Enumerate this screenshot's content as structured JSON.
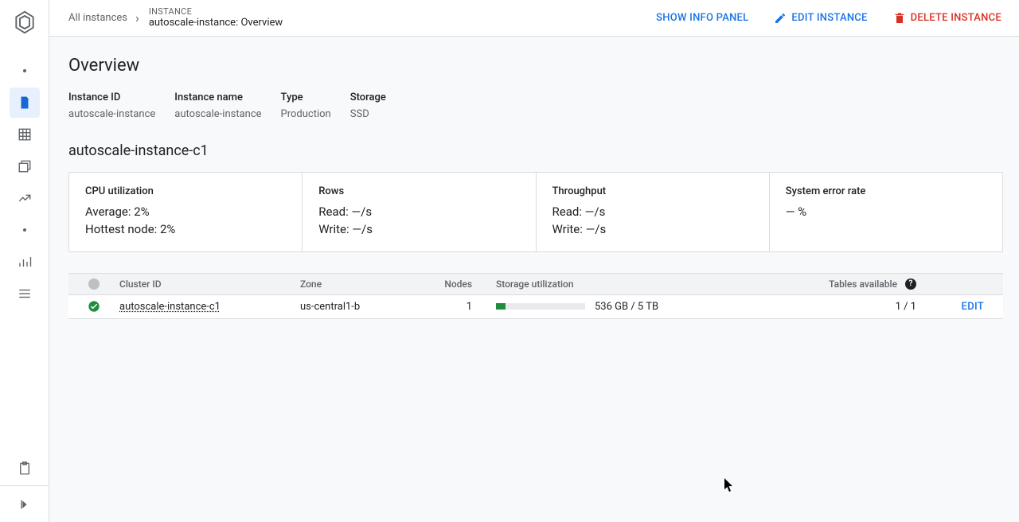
{
  "breadcrumbs": {
    "root": "All instances",
    "label": "INSTANCE",
    "title": "autoscale-instance: Overview"
  },
  "actions": {
    "show_info": "SHOW INFO PANEL",
    "edit": "EDIT INSTANCE",
    "delete": "DELETE INSTANCE"
  },
  "page": {
    "title": "Overview"
  },
  "info": {
    "instance_id_label": "Instance ID",
    "instance_id_value": "autoscale-instance",
    "instance_name_label": "Instance name",
    "instance_name_value": "autoscale-instance",
    "type_label": "Type",
    "type_value": "Production",
    "storage_label": "Storage",
    "storage_value": "SSD"
  },
  "cluster": {
    "name": "autoscale-instance-c1"
  },
  "metrics": {
    "cpu": {
      "title": "CPU utilization",
      "avg": "Average: 2%",
      "hot": "Hottest node: 2%"
    },
    "rows": {
      "title": "Rows",
      "read": "Read: —/s",
      "write": "Write: —/s"
    },
    "throughput": {
      "title": "Throughput",
      "read": "Read: —/s",
      "write": "Write: —/s"
    },
    "error": {
      "title": "System error rate",
      "value": "— %"
    }
  },
  "table": {
    "headers": {
      "cluster_id": "Cluster ID",
      "zone": "Zone",
      "nodes": "Nodes",
      "storage": "Storage utilization",
      "tables": "Tables available"
    },
    "row": {
      "cluster_id": "autoscale-instance-c1",
      "zone": "us-central1-b",
      "nodes": "1",
      "storage_text": "536 GB / 5 TB",
      "storage_pct": 11,
      "tables": "1 / 1",
      "edit": "EDIT"
    }
  }
}
